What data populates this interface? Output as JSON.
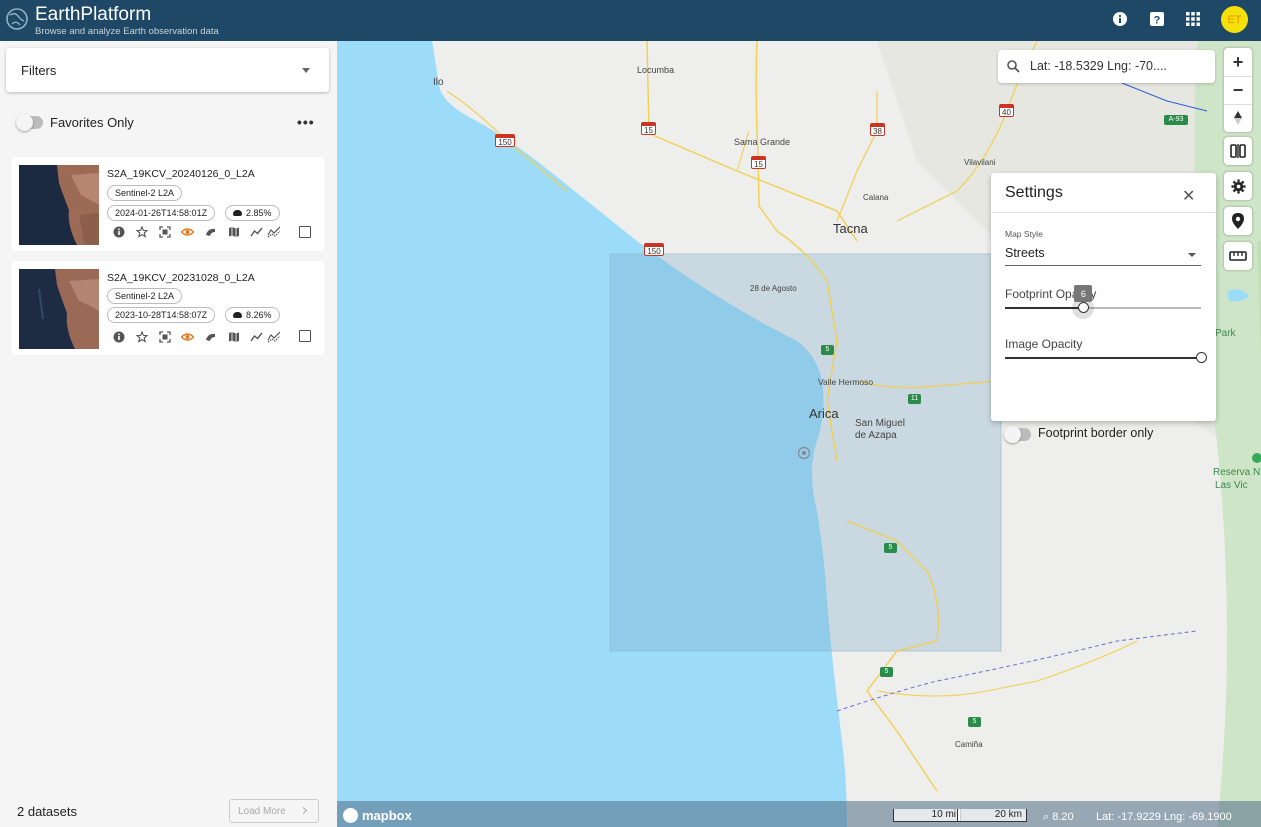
{
  "header": {
    "title": "EarthPlatform",
    "subtitle": "Browse and analyze Earth observation data",
    "avatar_initials": "ET",
    "icons": [
      "info-icon",
      "help-icon",
      "apps-grid-icon"
    ]
  },
  "sidebar": {
    "filters_label": "Filters",
    "favorites_label": "Favorites Only",
    "datasets": [
      {
        "name": "S2A_19KCV_20240126_0_L2A",
        "collection": "Sentinel-2 L2A",
        "datetime": "2024-01-26T14:58:01Z",
        "cloud_cover": "2.85%"
      },
      {
        "name": "S2A_19KCV_20231028_0_L2A",
        "collection": "Sentinel-2 L2A",
        "datetime": "2023-10-28T14:58:07Z",
        "cloud_cover": "8.26%"
      }
    ],
    "count_label": "2 datasets",
    "load_more_label": "Load More"
  },
  "map": {
    "search_text": "Lat: -18.5329 Lng: -70....",
    "places": {
      "ilo": "Ilo",
      "locumba": "Locumba",
      "sama_grande": "Sama Grande",
      "tacna": "Tacna",
      "calana": "Calana",
      "vilavilani": "Vilavilani",
      "agosto": "28 de Agosto",
      "valle_hermoso": "Valle Hermoso",
      "arica": "Arica",
      "san_miguel": "San Miguel",
      "de_azapa": "de Azapa",
      "camina": "Camiña",
      "park": "Park",
      "reserva": "Reserva N",
      "las_vic": "Las Vic"
    },
    "shields": {
      "r150a": "150",
      "r15a": "15",
      "r15b": "15",
      "r38": "38",
      "r40": "40",
      "r150b": "150",
      "a93": "A-93",
      "r5a": "5",
      "r11": "11",
      "r5b": "5",
      "r5c": "5",
      "r5d": "5"
    },
    "settings": {
      "title": "Settings",
      "map_style_label": "Map Style",
      "map_style_value": "Streets",
      "footprint_opacity_label": "Footprint Opacity",
      "footprint_opacity_value": "6",
      "footprint_opacity_fraction": 0.4,
      "image_opacity_label": "Image Opacity",
      "image_opacity_fraction": 1.0,
      "footprint_border_label": "Footprint border only"
    },
    "footer": {
      "brand": "mapbox",
      "scale_mi": "10 mi",
      "scale_km": "20 km",
      "zoom": "8.20",
      "coords": "Lat: -17.9229  Lng: -69.1900"
    }
  },
  "colors": {
    "header_bg": "#1f4866",
    "avatar_bg": "#f5e10a",
    "accent_orange": "#e07a20",
    "water": "#9ddcf9",
    "footprint": "#6fa7c4"
  }
}
